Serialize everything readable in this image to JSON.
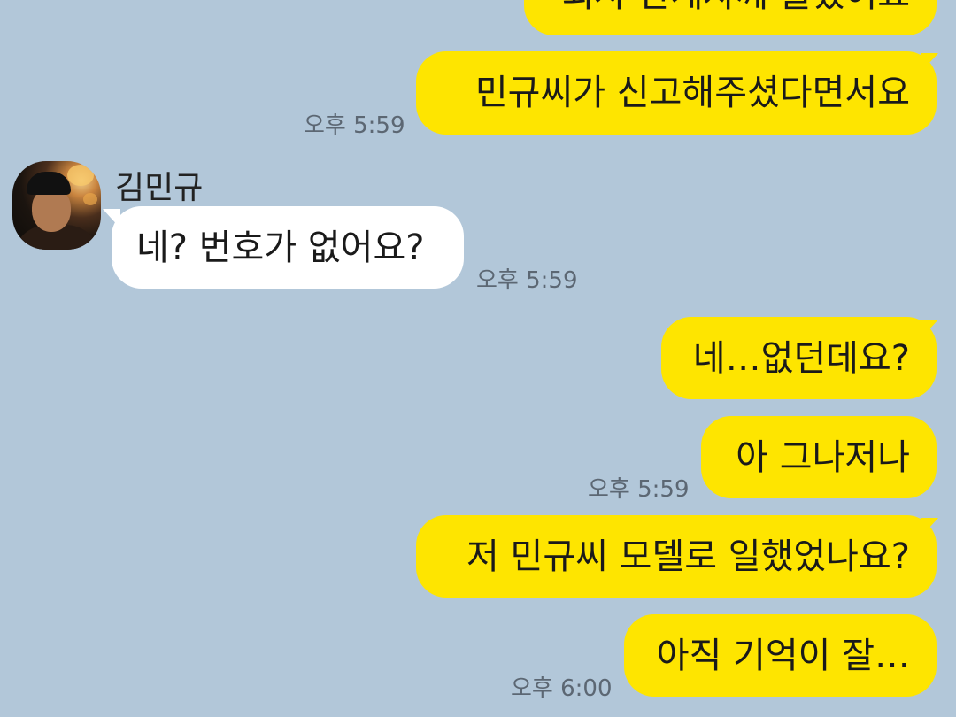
{
  "colors": {
    "background": "#b2c7d9",
    "outgoing_bubble": "#fee500",
    "incoming_bubble": "#ffffff",
    "timestamp": "#5c6773"
  },
  "chat": {
    "contact_name": "김민규",
    "avatar_icon": "profile-photo",
    "messages": [
      {
        "dir": "out",
        "text": "회사 관계자께 들었어요"
      },
      {
        "dir": "out",
        "text": "민규씨가 신고해주셨다면서요",
        "time": "오후 5:59"
      },
      {
        "dir": "in",
        "sender": "김민규",
        "text": "네? 번호가 없어요?",
        "time": "오후 5:59"
      },
      {
        "dir": "out",
        "text": "네…없던데요?"
      },
      {
        "dir": "out",
        "text": "아 그나저나",
        "time": "오후 5:59"
      },
      {
        "dir": "out",
        "text": "저 민규씨 모델로 일했었나요?"
      },
      {
        "dir": "out",
        "text": "아직 기억이 잘…",
        "time": "오후 6:00"
      }
    ]
  }
}
